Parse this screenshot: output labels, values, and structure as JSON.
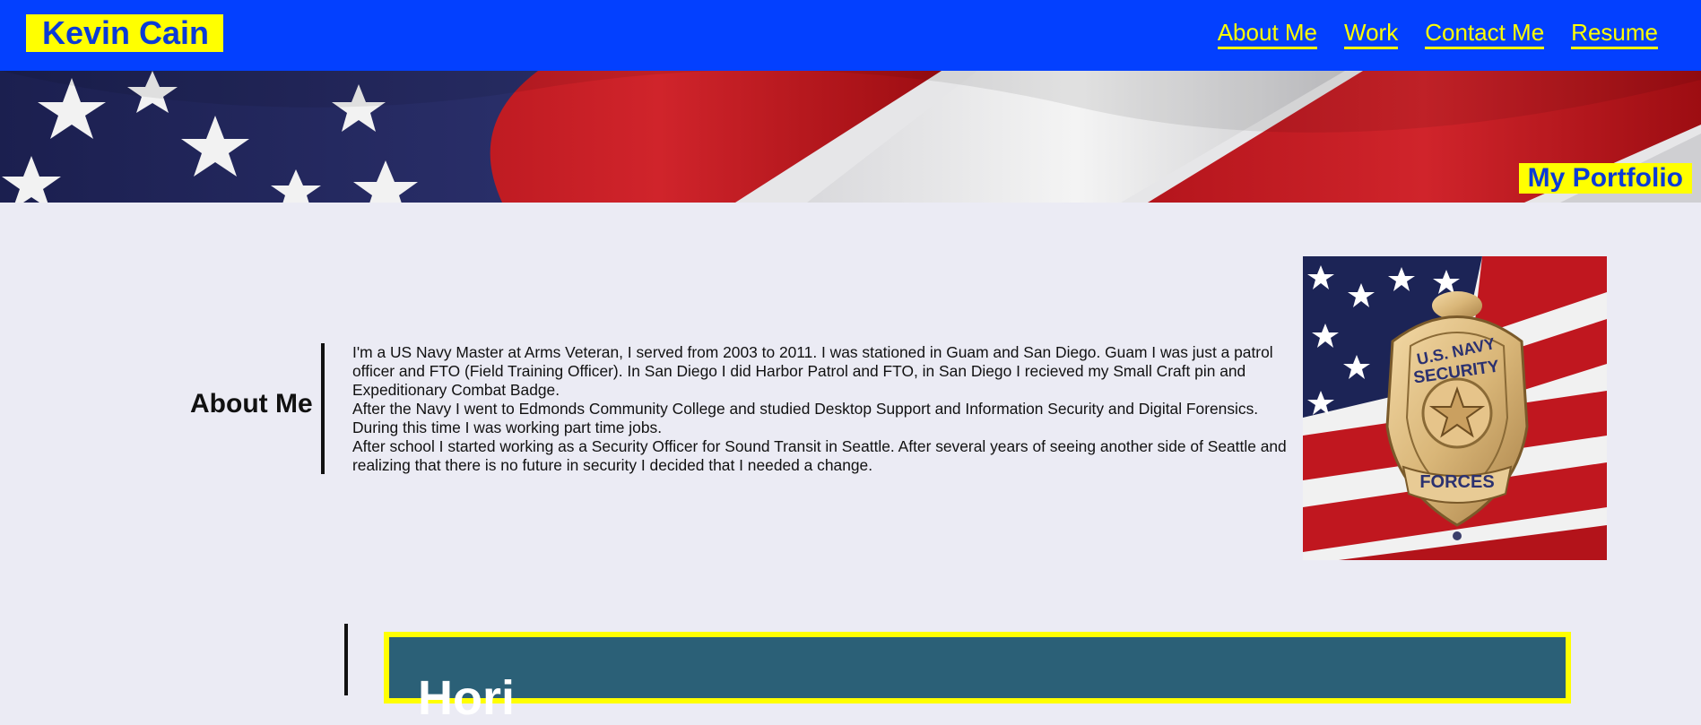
{
  "header": {
    "brand": "Kevin Cain",
    "nav": [
      "About Me",
      "Work",
      "Contact Me",
      "Resume"
    ]
  },
  "hero": {
    "label": "My Portfolio"
  },
  "about": {
    "heading": "About Me",
    "paragraphs": [
      "I'm a US Navy Master at Arms Veteran, I served from 2003 to 2011. I was stationed in Guam and San Diego. Guam I was just a patrol officer and FTO (Field Training Officer). In San Diego I did Harbor Patrol and FTO, in San Diego I recieved my Small Craft pin and Expeditionary Combat Badge.",
      "After the Navy I went to Edmonds Community College and studied Desktop Support and Information Security and Digital Forensics. During this time I was working part time jobs.",
      "After school I started working as a Security Officer for Sound Transit in Seattle. After several years of seeing another side of Seattle and realizing that there is no future in security I decided that I needed a change."
    ],
    "badge": {
      "top_text": "U.S. NAVY",
      "middle_text": "SECURITY",
      "bottom_text": "FORCES"
    }
  },
  "work": {
    "card_title": "Hori"
  },
  "colors": {
    "header_bg": "#0340ff",
    "accent_yellow": "#ffff00",
    "brand_text": "#0b3bd6",
    "page_bg": "#ebebf4",
    "card_bg": "#2b6077"
  }
}
